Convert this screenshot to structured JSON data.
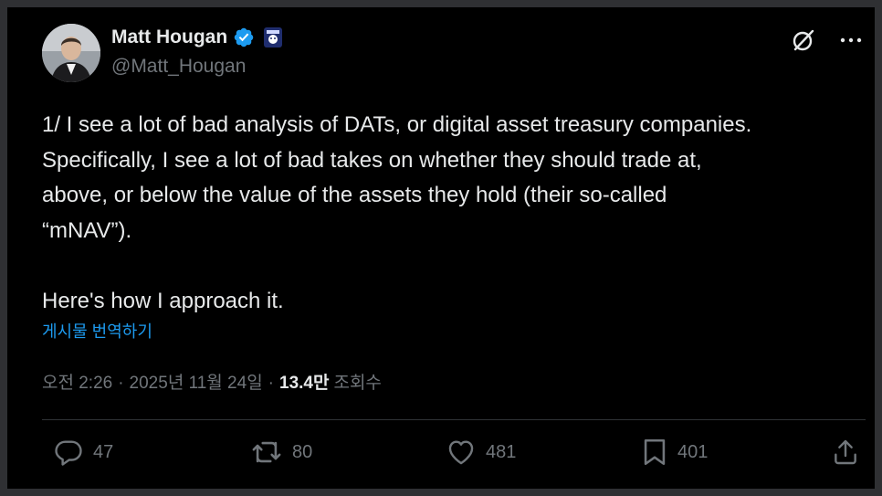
{
  "author": {
    "name": "Matt Hougan",
    "handle": "@Matt_Hougan",
    "avatar_icon": "avatar-portrait",
    "verified_icon": "verified-badge-icon",
    "affiliation_icon": "affiliate-badge-icon"
  },
  "tweet": {
    "lines": [
      "1/ I see a lot of bad analysis of DATs, or digital asset treasury companies.",
      "Specifically, I see a lot of bad takes on whether they should trade at,",
      "above, or below the value of the assets they hold (their so-called",
      "“mNAV”)."
    ],
    "closing": "Here's how I approach it."
  },
  "translate_label": "게시물 번역하기",
  "meta": {
    "time": "오전 2:26",
    "separator": "·",
    "date": "2025년 11월 24일",
    "views_count": "13.4만",
    "views_label": "조회수"
  },
  "actions": {
    "replies": "47",
    "reposts": "80",
    "likes": "481",
    "bookmarks": "401"
  },
  "colors": {
    "background": "#000000",
    "text": "#e7e9ea",
    "muted": "#71767b",
    "link": "#1d9bf0",
    "verified": "#1d9bf0"
  }
}
